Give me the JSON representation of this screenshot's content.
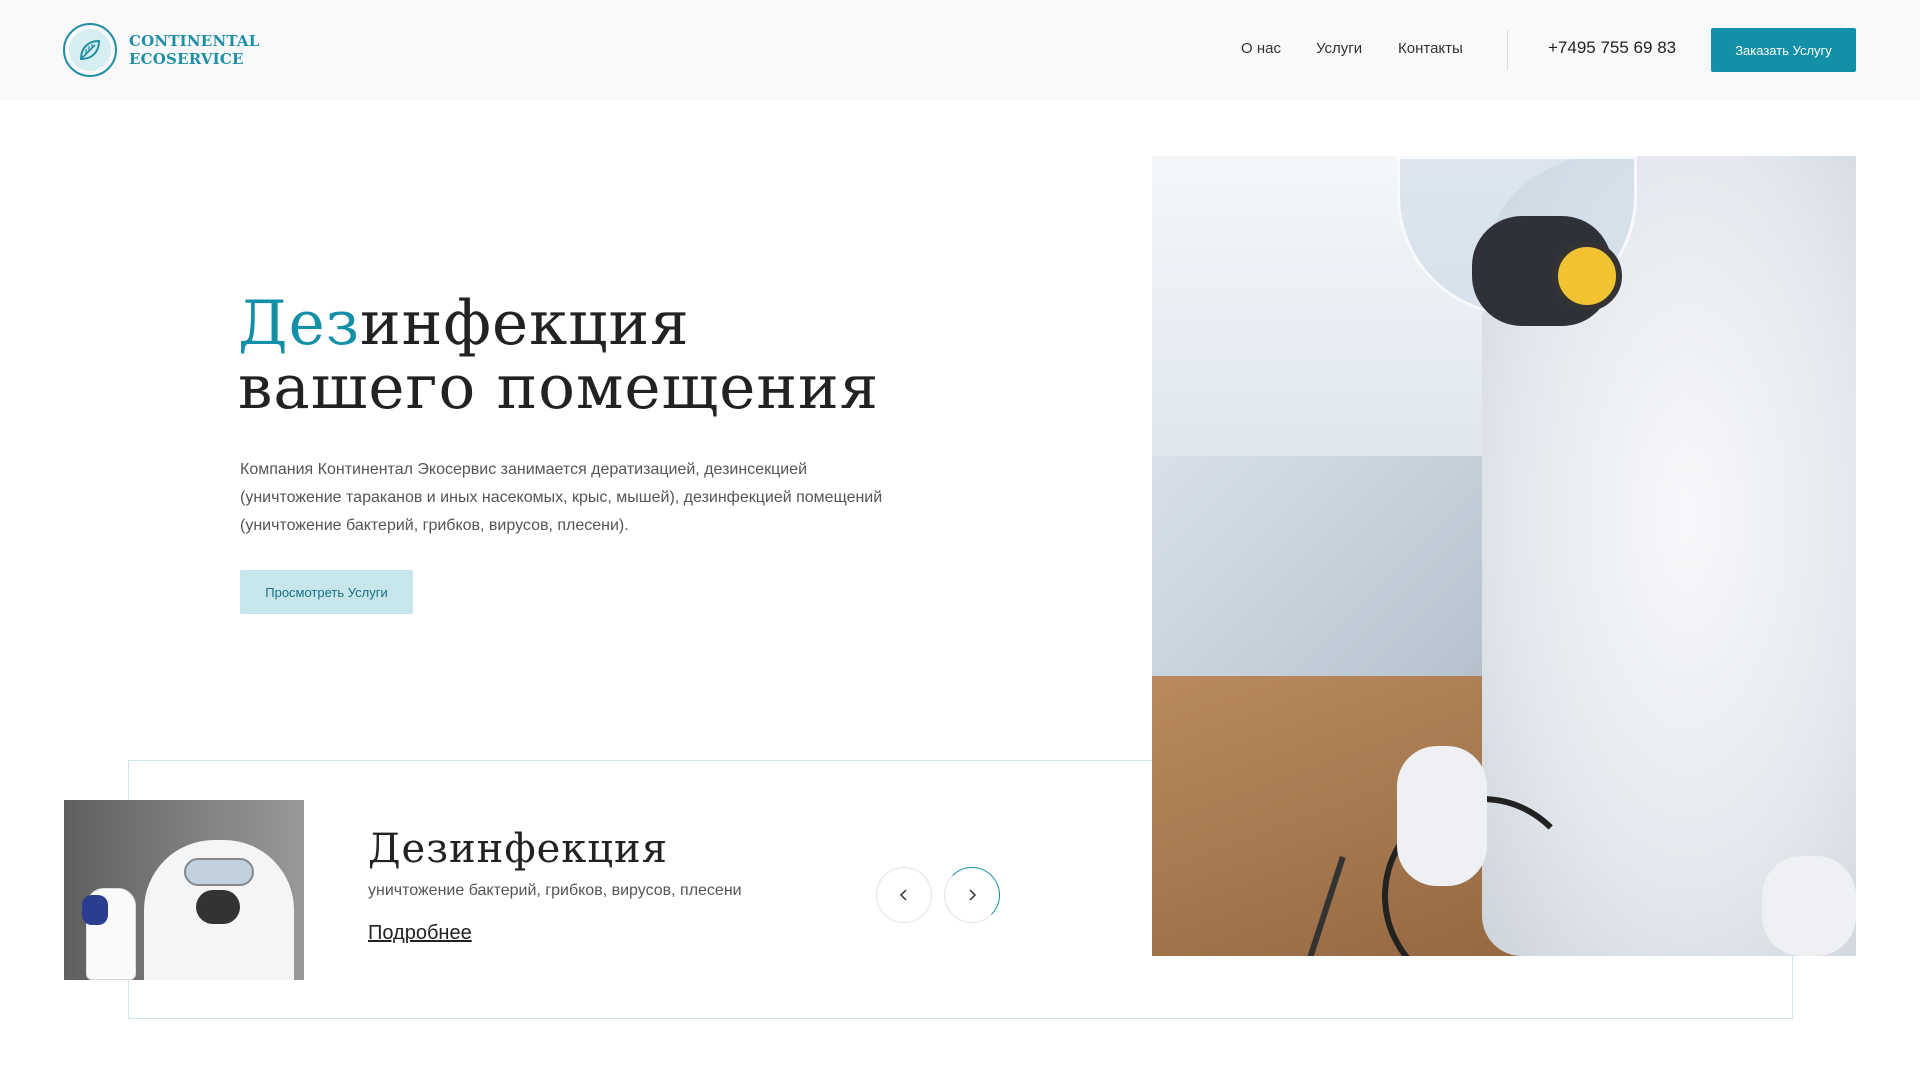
{
  "brand": {
    "line1": "CONTINENTAL",
    "line2": "ECOSERVICE",
    "accent_color": "#148fa8"
  },
  "nav": {
    "items": [
      {
        "label": "О нас"
      },
      {
        "label": "Услуги"
      },
      {
        "label": "Контакты"
      }
    ],
    "phone": "+7495 755 69 83",
    "order_button": "Заказать Услугу"
  },
  "hero": {
    "title_accent": "Дез",
    "title_rest_line1": "инфекция",
    "title_line2": "вашего помещения",
    "description": "Компания Континентал Экосервис занимается дератизацией, дезинсекцией (уничтожение тараканов и иных насекомых, крыс, мышей), дезинфекцией помещений (уничтожение бактерий, грибков, вирусов, плесени).",
    "cta": "Просмотреть Услуги"
  },
  "slider": {
    "title": "Дезинфекция",
    "description": "уничтожение бактерий, грибков, вирусов, плесени",
    "more_link": "Подробнее",
    "prev_icon": "chevron-left-icon",
    "next_icon": "chevron-right-icon"
  }
}
